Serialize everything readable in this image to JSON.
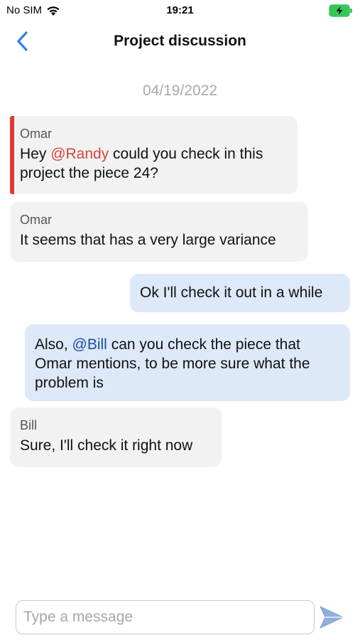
{
  "status_bar": {
    "carrier": "No SIM",
    "time": "19:21",
    "wifi_icon": "wifi-icon",
    "battery_icon": "battery-charging-icon",
    "battery_color": "#35c759"
  },
  "nav": {
    "title": "Project discussion",
    "back_icon": "chevron-left-icon",
    "accent": "#2d7cf6"
  },
  "chat": {
    "date": "04/19/2022",
    "messages": [
      {
        "direction": "incoming",
        "sender": "Omar",
        "text_before": "Hey ",
        "mention": "@Randy",
        "text_after": " could you check in this project the piece 24?",
        "highlighted": true,
        "highlight_color": "#e23a32"
      },
      {
        "direction": "incoming",
        "sender": "Omar",
        "text": "It seems that has a very large variance"
      },
      {
        "direction": "outgoing",
        "text": "Ok I'll check it out in a while"
      },
      {
        "direction": "outgoing",
        "text_before": "Also, ",
        "mention": "@Bill",
        "text_after": " can you check the piece that Omar mentions, to be more sure what the problem is"
      },
      {
        "direction": "incoming",
        "sender": "Bill",
        "text": "Sure, I'll check it right now"
      }
    ]
  },
  "composer": {
    "placeholder": "Type a message",
    "value": "",
    "send_icon": "send-icon"
  },
  "colors": {
    "incoming_bubble": "#f2f2f3",
    "outgoing_bubble": "#dde9f9",
    "mention_incoming": "#d8443c",
    "mention_outgoing": "#1f4aa8",
    "date_text": "#a9a9ad"
  }
}
